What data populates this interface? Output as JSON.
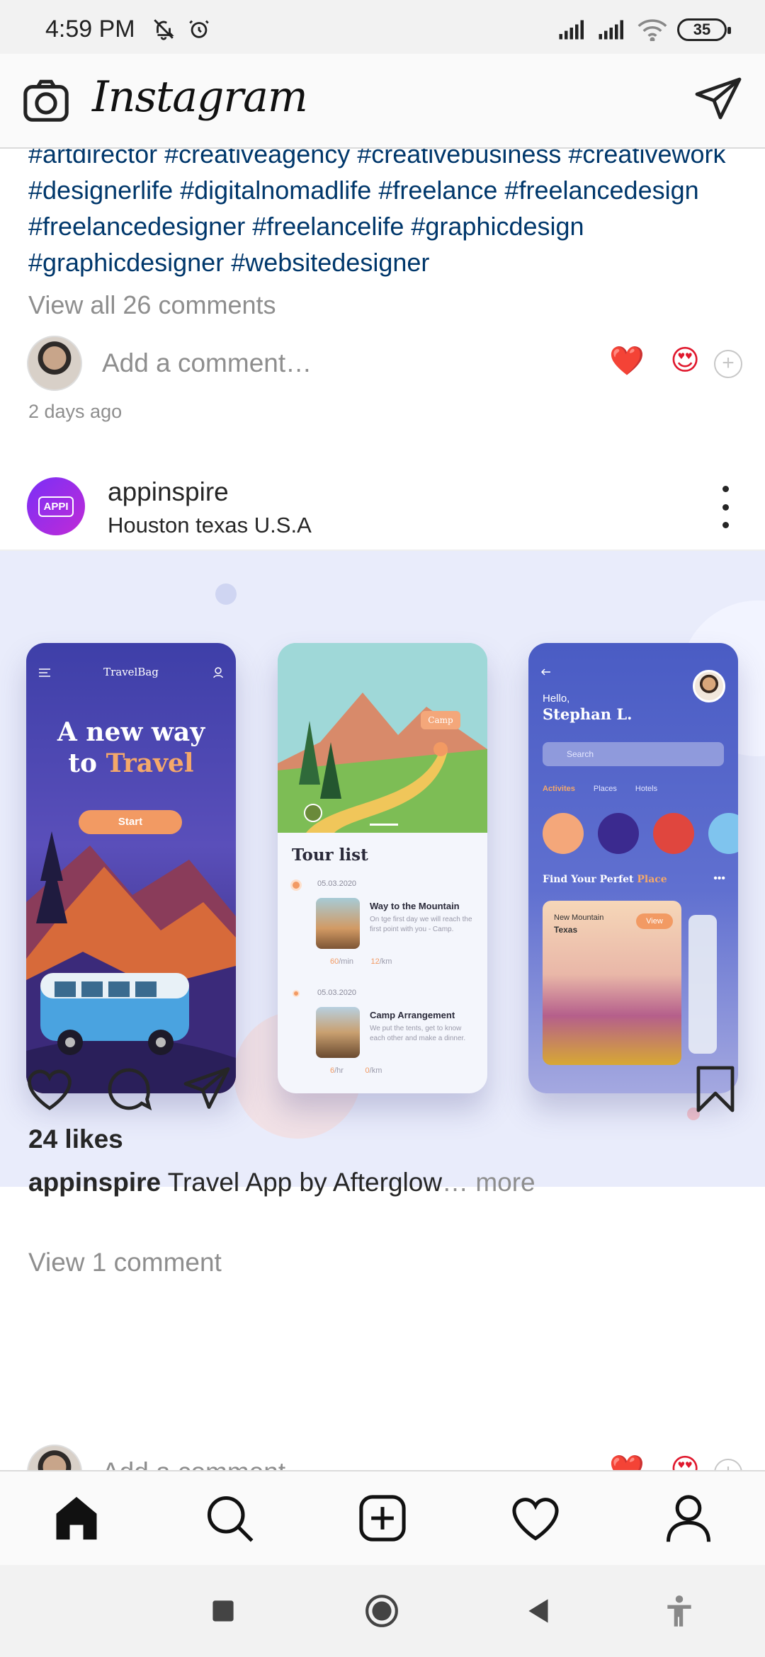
{
  "status_bar": {
    "time": "4:59 PM",
    "icons": [
      "mute-icon",
      "alarm-icon",
      "signal-icon",
      "signal-icon",
      "wifi-icon"
    ],
    "battery": "35"
  },
  "header": {
    "brand": "Instagram",
    "icons": [
      "camera-icon",
      "direct-message-icon"
    ]
  },
  "previous_post": {
    "caption_tail": "#artdirector #creativeagency #creativebusiness #creativework #designerlife #digitalnomadlife #freelance #freelancedesign #freelancedesigner #freelancelife #graphicdesign #graphicdesigner #websitedesigner",
    "view_all": "View all 26 comments",
    "add_comment_placeholder": "Add a comment…",
    "time_ago": "2 days ago",
    "quick_reactions": [
      "❤️",
      "😍",
      "+"
    ]
  },
  "post": {
    "username": "appinspire",
    "location": "Houston texas U.S.A",
    "avatar_label": "APPI",
    "image": {
      "screen1": {
        "brand": "TravelBag",
        "title_a": "A new way",
        "title_b1": "to ",
        "title_b2": "Travel",
        "button": "Start"
      },
      "screen2": {
        "tag": "Camp",
        "title": "Tour list",
        "items": [
          {
            "date": "05.03.2020",
            "name": "Way to the Mountain",
            "desc": "On tge first day we will reach the first point with you - Camp.",
            "meta1_val": "60",
            "meta1_unit": "/min",
            "meta2_val": "12",
            "meta2_unit": "/km"
          },
          {
            "date": "05.03.2020",
            "name": "Camp Arrangement",
            "desc": "We put the tents, get to know each other and make a dinner.",
            "meta1_val": "6",
            "meta1_unit": "/hr",
            "meta2_val": "0",
            "meta2_unit": "/km"
          }
        ]
      },
      "screen3": {
        "hello": "Hello,",
        "name": "Stephan L.",
        "search": "Search",
        "tabs": [
          "Activites",
          "Places",
          "Hotels"
        ],
        "find_a": "Find Your Perfet ",
        "find_b": "Place",
        "card_title": "New Mountain",
        "card_sub": "Texas",
        "card_button": "View"
      }
    },
    "likes": "24 likes",
    "caption_user": "appinspire",
    "caption_text": " Travel App by Afterglow",
    "caption_more_ellipsis": "…",
    "caption_more": " more",
    "view_comments": "View 1 comment",
    "add_comment_placeholder": "Add a comment…"
  },
  "actions": [
    "like-icon",
    "comment-icon",
    "share-icon",
    "save-icon"
  ],
  "bottom_nav": [
    "home-icon",
    "search-icon",
    "new-post-icon",
    "activity-icon",
    "profile-icon"
  ],
  "system_nav": [
    "recents-icon",
    "home-circle-icon",
    "back-icon",
    "accessibility-icon"
  ],
  "colors": {
    "hashtag": "#00376b",
    "secondary_text": "#8e8e8e",
    "accent_orange": "#f29a63",
    "image_bg": "#e9ecfb"
  }
}
